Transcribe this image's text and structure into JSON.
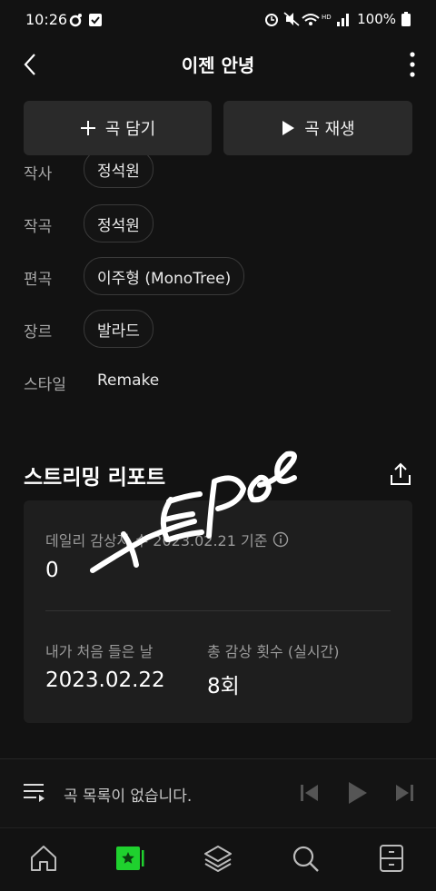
{
  "status_bar": {
    "time": "10:26",
    "battery": "100%"
  },
  "header": {
    "title": "이젠 안녕"
  },
  "actions": {
    "add_label": "곡 담기",
    "play_label": "곡 재생"
  },
  "credits": [
    {
      "label": "작사",
      "value": "정석원"
    },
    {
      "label": "작곡",
      "value": "정석원"
    },
    {
      "label": "편곡",
      "value": "이주형 (MonoTree)"
    },
    {
      "label": "장르",
      "value": "발라드"
    },
    {
      "label": "스타일",
      "value": "Remake"
    }
  ],
  "report": {
    "title": "스트리밍 리포트",
    "daily_label": "데일리 감상자 수 2023.02.21 기준",
    "daily_value": "0",
    "first_label": "내가 처음 들은 날",
    "first_value": "2023.02.22",
    "total_label": "총 감상 횟수 (실시간)",
    "total_value": "8회"
  },
  "player": {
    "text": "곡 목록이 없습니다."
  },
  "colors": {
    "accent": "#1fd12e",
    "background": "#121212",
    "surface": "#1e1e1e"
  },
  "nav": [
    "home-icon",
    "my-music-icon",
    "layers-icon",
    "search-icon",
    "drawer-icon"
  ]
}
